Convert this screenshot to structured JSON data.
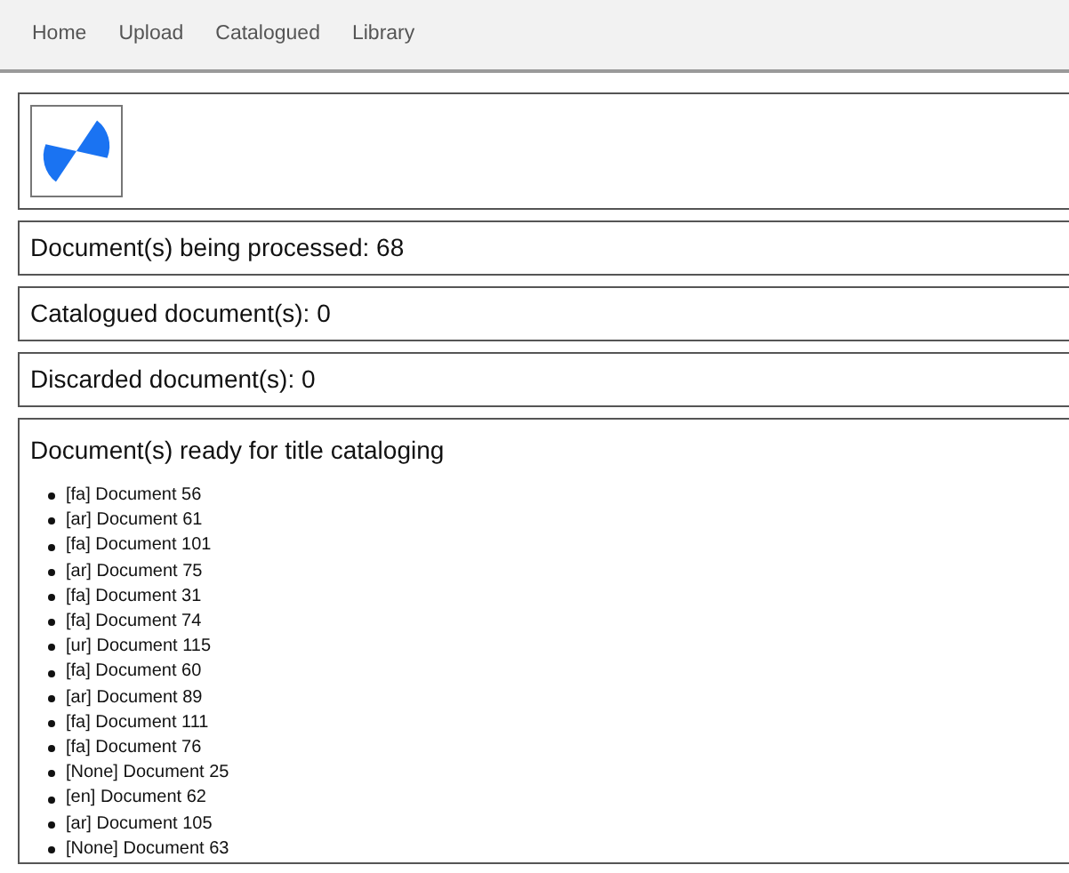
{
  "nav": [
    {
      "label": "Home"
    },
    {
      "label": "Upload"
    },
    {
      "label": "Catalogued"
    },
    {
      "label": "Library"
    }
  ],
  "stats": [
    {
      "text": "Document(s) being processed: 68"
    },
    {
      "text": "Catalogued document(s): 0"
    },
    {
      "text": "Discarded document(s): 0"
    }
  ],
  "ready": {
    "title": "Document(s) ready for title cataloging",
    "items": [
      "[fa] Document 56",
      "[ar] Document 61",
      "[fa] Document 101",
      "[ar] Document 75",
      "[fa] Document 31",
      "[fa] Document 74",
      "[ur] Document 115",
      "[fa] Document 60",
      "[ar] Document 89",
      "[fa] Document 111",
      "[fa] Document 76",
      "[None] Document 25",
      "[en] Document 62",
      "[ar] Document 105",
      "[None] Document 63"
    ]
  }
}
